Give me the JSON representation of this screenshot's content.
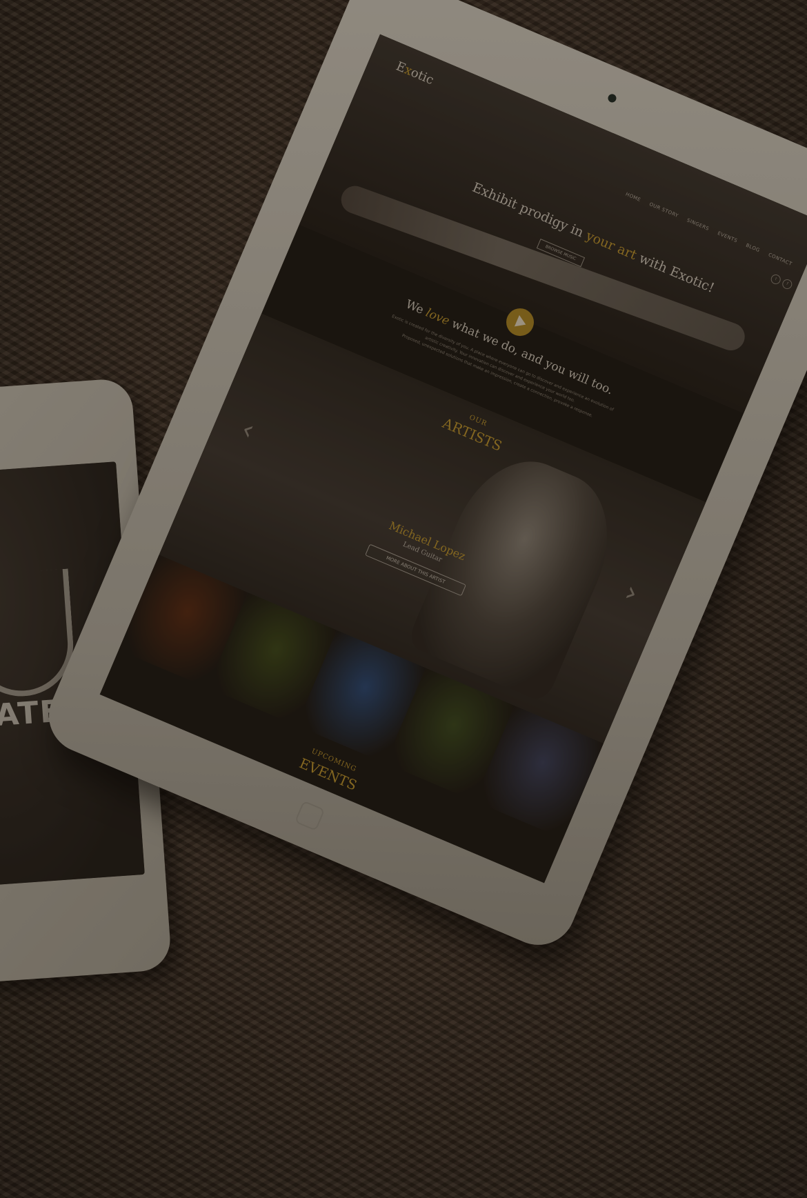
{
  "phone": {
    "text": "ATE"
  },
  "site": {
    "logo_prefix": "E",
    "logo_accent": "x",
    "logo_suffix": "otic",
    "nav": [
      "HOME",
      "OUR STORY",
      "SINGERS",
      "EVENTS",
      "BLOG",
      "CONTACT"
    ],
    "social": [
      "t",
      "f"
    ],
    "hero_title_a": "Exhibit prodigy in ",
    "hero_title_accent": "your art",
    "hero_title_b": " with Exotic!",
    "hero_button": "BROWSE MUSIC",
    "love_a": "We ",
    "love_script": "love",
    "love_b": " what we do, and you will too.",
    "love_body_1": "Exotic is created for the diversity of you. A place where everyone can go to discover and experience an evolution of artistic creativity. Your innovation can discover and experience your world too.",
    "love_body_2": "Proposed, unexpected solutions that make an impression, create a connection, provoke a response.",
    "artists_kicker": "OUR",
    "artists_head": "ARTISTS",
    "artist_name": "Michael Lopez",
    "artist_role": "Lead Guitar",
    "artist_button": "MORE ABOUT THIS ARTIST",
    "arrow_left": "‹",
    "arrow_right": "›",
    "events_kicker": "UPCOMING",
    "events_head": "EVENTS"
  },
  "colors": {
    "accent": "#c49a2e",
    "thumbs": [
      "#5a2a12",
      "#3d4a1a",
      "#2a4a7a",
      "#3a4a1e",
      "#3a3f5c"
    ]
  }
}
